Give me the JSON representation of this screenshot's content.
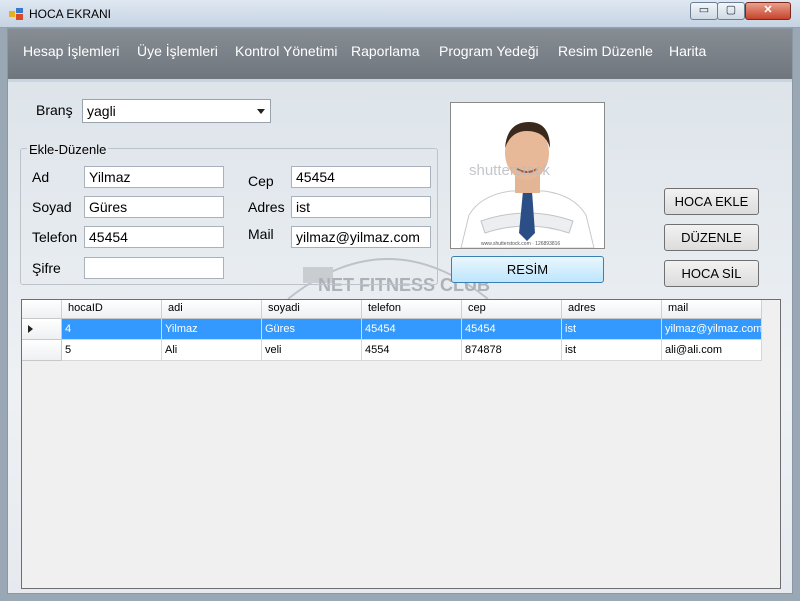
{
  "window": {
    "title": "HOCA EKRANI",
    "minimize": "▭",
    "maximize": "▢",
    "close": "✕"
  },
  "menu": [
    "Hesap İşlemleri",
    "Üye İşlemleri",
    "Kontrol Yönetimi",
    "Raporlama",
    "Program Yedeği",
    "Resim Düzenle",
    "Harita"
  ],
  "brans": {
    "label": "Branş",
    "value": "yagli"
  },
  "group": {
    "title": "Ekle-Düzenle",
    "ad": {
      "label": "Ad",
      "value": "Yilmaz"
    },
    "soyad": {
      "label": "Soyad",
      "value": "Güres"
    },
    "telefon": {
      "label": "Telefon",
      "value": "45454"
    },
    "sifre": {
      "label": "Şifre",
      "value": ""
    },
    "cep": {
      "label": "Cep",
      "value": "45454"
    },
    "adres": {
      "label": "Adres",
      "value": "ist"
    },
    "mail": {
      "label": "Mail",
      "value": "yilmaz@yilmaz.com"
    }
  },
  "photo": {
    "watermark_text": "shutterstock",
    "caption": "www.shutterstock.com · 126893816"
  },
  "background_watermark": "NET FITNESS CLUB",
  "buttons": {
    "resim": "RESİM",
    "ekle": "HOCA EKLE",
    "duzenle": "DÜZENLE",
    "sil": "HOCA SİL"
  },
  "table": {
    "columns": [
      "hocaID",
      "adi",
      "soyadi",
      "telefon",
      "cep",
      "adres",
      "mail"
    ],
    "rows": [
      [
        "4",
        "Yilmaz",
        "Güres",
        "45454",
        "45454",
        "ist",
        "yilmaz@yilmaz.com"
      ],
      [
        "5",
        "Ali",
        "veli",
        "4554",
        "874878",
        "ist",
        "ali@ali.com"
      ]
    ],
    "selected_row": 0
  },
  "colors": {
    "selection": "#3399ff",
    "menu_bg": "#7a8087"
  }
}
